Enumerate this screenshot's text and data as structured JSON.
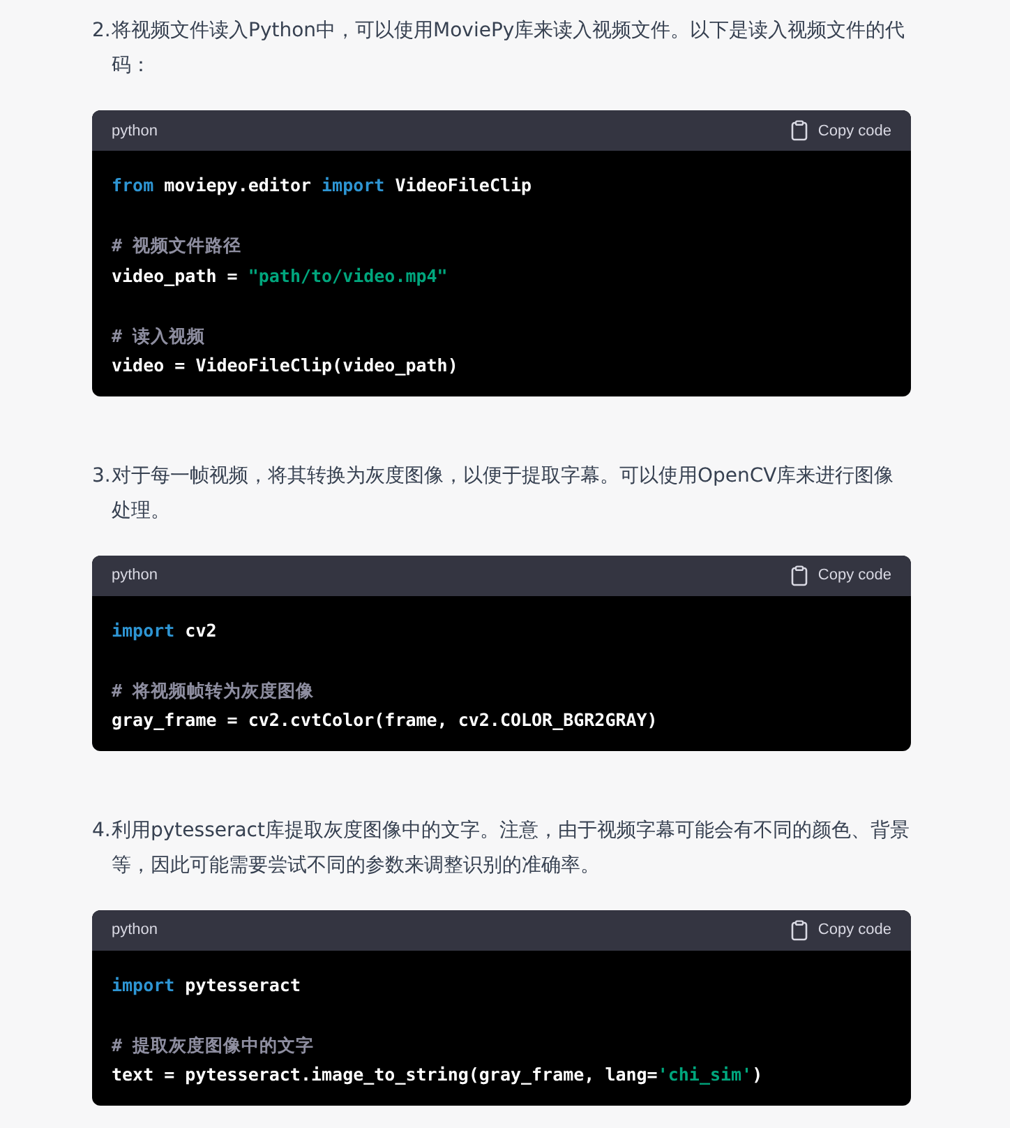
{
  "steps": [
    {
      "number": "2.",
      "text": "将视频文件读入Python中，可以使用MoviePy库来读入视频文件。以下是读入视频文件的代码：",
      "code": {
        "language": "python",
        "copy_label": "Copy code",
        "lines": [
          {
            "kind": "code",
            "tokens": [
              {
                "kind": "keyword",
                "text": "from"
              },
              {
                "kind": "plain",
                "text": " moviepy.editor "
              },
              {
                "kind": "keyword",
                "text": "import"
              },
              {
                "kind": "plain",
                "text": " VideoFileClip"
              }
            ]
          },
          {
            "kind": "blank"
          },
          {
            "kind": "code",
            "tokens": [
              {
                "kind": "comment",
                "text": "# 视频文件路径"
              }
            ]
          },
          {
            "kind": "code",
            "tokens": [
              {
                "kind": "plain",
                "text": "video_path = "
              },
              {
                "kind": "string",
                "text": "\"path/to/video.mp4\""
              }
            ]
          },
          {
            "kind": "blank"
          },
          {
            "kind": "code",
            "tokens": [
              {
                "kind": "comment",
                "text": "# 读入视频"
              }
            ]
          },
          {
            "kind": "code",
            "tokens": [
              {
                "kind": "plain",
                "text": "video = VideoFileClip(video_path)"
              }
            ]
          }
        ]
      }
    },
    {
      "number": "3.",
      "text": "对于每一帧视频，将其转换为灰度图像，以便于提取字幕。可以使用OpenCV库来进行图像处理。",
      "code": {
        "language": "python",
        "copy_label": "Copy code",
        "lines": [
          {
            "kind": "code",
            "tokens": [
              {
                "kind": "keyword",
                "text": "import"
              },
              {
                "kind": "plain",
                "text": " cv2"
              }
            ]
          },
          {
            "kind": "blank"
          },
          {
            "kind": "code",
            "tokens": [
              {
                "kind": "comment",
                "text": "# 将视频帧转为灰度图像"
              }
            ]
          },
          {
            "kind": "code",
            "tokens": [
              {
                "kind": "plain",
                "text": "gray_frame = cv2.cvtColor(frame, cv2.COLOR_BGR2GRAY)"
              }
            ]
          }
        ]
      }
    },
    {
      "number": "4.",
      "text": "利用pytesseract库提取灰度图像中的文字。注意，由于视频字幕可能会有不同的颜色、背景等，因此可能需要尝试不同的参数来调整识别的准确率。",
      "code": {
        "language": "python",
        "copy_label": "Copy code",
        "lines": [
          {
            "kind": "code",
            "tokens": [
              {
                "kind": "keyword",
                "text": "import"
              },
              {
                "kind": "plain",
                "text": " pytesseract"
              }
            ]
          },
          {
            "kind": "blank"
          },
          {
            "kind": "code",
            "tokens": [
              {
                "kind": "comment",
                "text": "# 提取灰度图像中的文字"
              }
            ]
          },
          {
            "kind": "code",
            "tokens": [
              {
                "kind": "plain",
                "text": "text = pytesseract.image_to_string(gray_frame, lang="
              },
              {
                "kind": "string",
                "text": "'chi_sim'"
              },
              {
                "kind": "plain",
                "text": ")"
              }
            ]
          }
        ]
      }
    }
  ]
}
